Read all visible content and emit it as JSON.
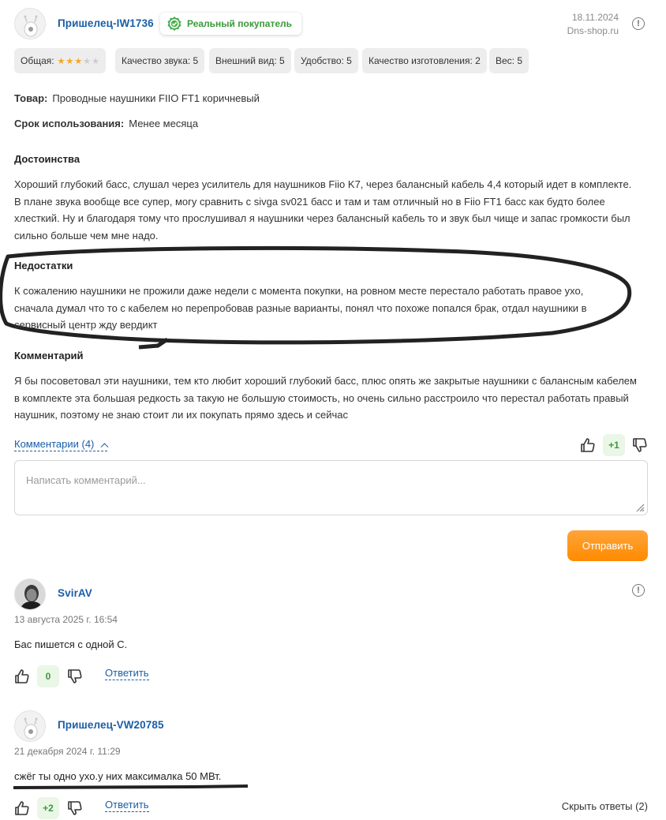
{
  "review": {
    "username": "Пришелец-IW1736",
    "badge_label": "Реальный покупатель",
    "date": "18.11.2024",
    "source": "Dns-shop.ru",
    "ratings": [
      {
        "label": "Общая:",
        "stars": 3,
        "max": 5
      },
      {
        "label": "Качество звука: 5"
      },
      {
        "label": "Внешний вид: 5"
      },
      {
        "label": "Удобство: 5"
      },
      {
        "label": "Качество изготовления: 2"
      },
      {
        "label": "Вес: 5"
      }
    ],
    "product_label": "Товар:",
    "product_value": "Проводные наушники FIIO FT1 коричневый",
    "usage_label": "Срок использования:",
    "usage_value": "Менее месяца",
    "pros_title": "Достоинства",
    "pros_text": "Хороший глубокий басс, слушал через усилитель для наушников Fiio K7, через балансный кабель 4,4 который идет в комплекте. В плане звука вообще все супер, могу сравнить с sivga sv021 басс и там и там отличный но в Fiio FT1 басс как будто более хлесткий. Ну и благодаря тому что   прослушивал я наушники через балансный кабель то и звук был чище и запас громкости был сильно больше чем мне надо.",
    "cons_title": "Недостатки",
    "cons_text": "К сожалению наушники не прожили даже недели с момента покупки, на ровном месте перестало работать правое ухо, сначала думал что то с кабелем но перепробовав разные варианты, понял что похоже попался брак, отдал наушники в сервисный центр жду вердикт",
    "comment_title": "Комментарий",
    "comment_text": "Я бы посоветовал эти наушники, тем кто любит хороший глубокий басс, плюс опять же закрытые наушники с балансным кабелем в комплекте эта большая редкость за такую не большую стоимость, но очень сильно расстроило что перестал работать правый наушник, поэтому не знаю стоит ли их покупать прямо здесь и сейчас",
    "comments_toggle": "Комментарии (4)",
    "vote_count": "+1"
  },
  "comment_form": {
    "placeholder": "Написать комментарий...",
    "submit_label": "Отправить"
  },
  "comments": [
    {
      "username": "SvirAV",
      "date": "13 августа 2025 г. 16:54",
      "text": "Бас пишется с одной С.",
      "vote_count": "0",
      "reply_label": "Ответить"
    },
    {
      "username": "Пришелец-VW20785",
      "date": "21 декабря 2024 г. 11:29",
      "text": "сжёг ты одно ухо.у них максималка 50 МВт.",
      "vote_count": "+2",
      "reply_label": "Ответить",
      "hide_replies_label": "Скрыть ответы (2)"
    }
  ],
  "colors": {
    "link": "#1a5ea8",
    "badge_green": "#3a9a3a",
    "star_on": "#f5a623",
    "button_orange": "#ff8a00"
  }
}
